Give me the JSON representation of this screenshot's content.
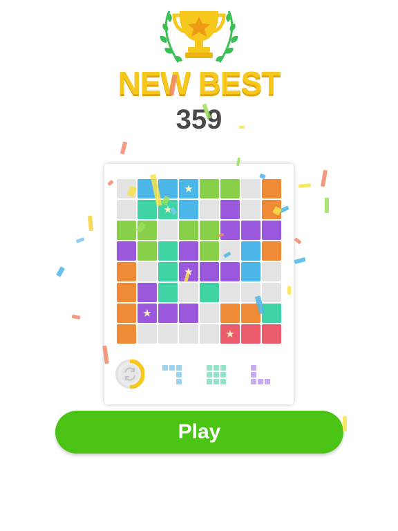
{
  "header": {
    "title": "NEW BEST",
    "score": "359"
  },
  "icons": {
    "trophy": "trophy-star-icon",
    "laurel": "laurel-icon",
    "rotate": "rotate-icon",
    "star": "star-icon"
  },
  "palette": {
    "grey": "#e3e3e3",
    "blue": "#4db6e8",
    "green": "#88d04a",
    "orange": "#ef8a37",
    "teal": "#3fd3a5",
    "purple": "#9a58dd",
    "red": "#ea5b6b",
    "gold": "#f6c81e",
    "play": "#4cc416"
  },
  "board": {
    "rows": [
      [
        "grey",
        "blue",
        "blue",
        "blue*",
        "green",
        "green",
        "grey",
        "orange"
      ],
      [
        "grey",
        "teal",
        "teal*",
        "blue",
        "grey",
        "purple",
        "grey",
        "orange"
      ],
      [
        "green",
        "green",
        "grey",
        "green",
        "green",
        "purple",
        "purple",
        "purple"
      ],
      [
        "purple",
        "green",
        "teal",
        "purple",
        "green",
        "grey",
        "blue",
        "orange"
      ],
      [
        "orange",
        "grey",
        "teal",
        "purple*",
        "purple",
        "purple",
        "blue",
        "grey"
      ],
      [
        "orange",
        "purple",
        "teal",
        "grey",
        "teal",
        "grey",
        "grey",
        "grey"
      ],
      [
        "orange",
        "purple*",
        "purple",
        "purple",
        "grey",
        "orange",
        "orange",
        "teal"
      ],
      [
        "orange",
        "grey",
        "grey",
        "grey",
        "grey",
        "red*",
        "red",
        "red"
      ]
    ]
  },
  "tray": {
    "pieces": [
      {
        "name": "piece-hook",
        "color": "#9ed3f0",
        "cells": [
          [
            0,
            0
          ],
          [
            0,
            1
          ],
          [
            0,
            2
          ],
          [
            1,
            2
          ],
          [
            2,
            2
          ]
        ]
      },
      {
        "name": "piece-square",
        "color": "#92e3c9",
        "cells": [
          [
            0,
            0
          ],
          [
            0,
            1
          ],
          [
            0,
            2
          ],
          [
            1,
            0
          ],
          [
            1,
            1
          ],
          [
            1,
            2
          ],
          [
            2,
            0
          ],
          [
            2,
            1
          ],
          [
            2,
            2
          ]
        ]
      },
      {
        "name": "piece-corner",
        "color": "#c7aaf0",
        "cells": [
          [
            0,
            0
          ],
          [
            1,
            0
          ],
          [
            2,
            0
          ],
          [
            2,
            1
          ],
          [
            2,
            2
          ]
        ]
      }
    ]
  },
  "play": {
    "label": "Play"
  }
}
